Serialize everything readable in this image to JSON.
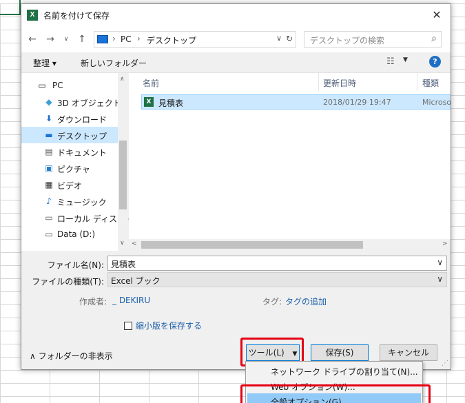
{
  "dialog": {
    "title": "名前を付けて保存",
    "title_icon": "X",
    "close": "✕"
  },
  "address": {
    "segments": [
      "PC",
      "デスクトップ"
    ],
    "search_placeholder": "デスクトップの検索"
  },
  "toolbar": {
    "organize": "整理 ▾",
    "new_folder": "新しいフォルダー"
  },
  "nav": {
    "items": [
      {
        "label": "PC"
      },
      {
        "label": "3D オブジェクト"
      },
      {
        "label": "ダウンロード"
      },
      {
        "label": "デスクトップ"
      },
      {
        "label": "ドキュメント"
      },
      {
        "label": "ピクチャ"
      },
      {
        "label": "ビデオ"
      },
      {
        "label": "ミュージック"
      },
      {
        "label": "ローカル ディスク (C"
      },
      {
        "label": "Data (D:)"
      }
    ]
  },
  "files": {
    "columns": [
      "名前",
      "更新日時",
      "種類"
    ],
    "rows": [
      {
        "name": "見積表",
        "date": "2018/01/29 19:47",
        "type": "Microso"
      }
    ]
  },
  "form": {
    "filename_label": "ファイル名(N):",
    "filename_value": "見積表",
    "filetype_label": "ファイルの種類(T):",
    "filetype_value": "Excel ブック",
    "author_label": "作成者:",
    "author_value": "_ DEKIRU",
    "tags_label": "タグ:",
    "tags_value": "タグの追加",
    "thumbnail_label": "縮小版を保存する"
  },
  "footer": {
    "hide_folders": "フォルダーの非表示",
    "tools": "ツール(L)",
    "save": "保存(S)",
    "cancel": "キャンセル"
  },
  "menu": {
    "items": [
      {
        "label": "ネットワーク ドライブの割り当て(N)..."
      },
      {
        "label": "Web オプション(W)..."
      },
      {
        "label": "全般オプション(G)..."
      }
    ]
  },
  "colors": {
    "highlight": "#cce8ff",
    "accent": "#0078d7",
    "callout": "#e60012",
    "excel": "#1e7145"
  }
}
